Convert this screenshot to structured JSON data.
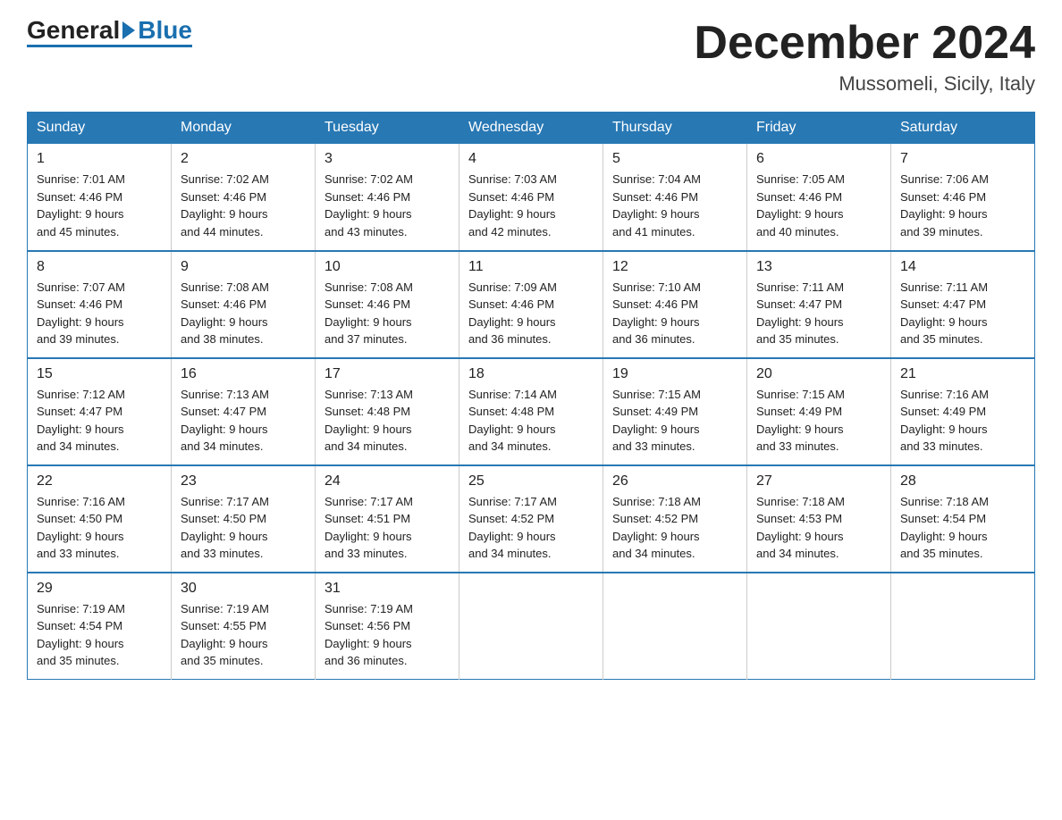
{
  "logo": {
    "general": "General",
    "blue": "Blue"
  },
  "header": {
    "month": "December 2024",
    "location": "Mussomeli, Sicily, Italy"
  },
  "days_of_week": [
    "Sunday",
    "Monday",
    "Tuesday",
    "Wednesday",
    "Thursday",
    "Friday",
    "Saturday"
  ],
  "weeks": [
    [
      {
        "num": "1",
        "info": "Sunrise: 7:01 AM\nSunset: 4:46 PM\nDaylight: 9 hours\nand 45 minutes."
      },
      {
        "num": "2",
        "info": "Sunrise: 7:02 AM\nSunset: 4:46 PM\nDaylight: 9 hours\nand 44 minutes."
      },
      {
        "num": "3",
        "info": "Sunrise: 7:02 AM\nSunset: 4:46 PM\nDaylight: 9 hours\nand 43 minutes."
      },
      {
        "num": "4",
        "info": "Sunrise: 7:03 AM\nSunset: 4:46 PM\nDaylight: 9 hours\nand 42 minutes."
      },
      {
        "num": "5",
        "info": "Sunrise: 7:04 AM\nSunset: 4:46 PM\nDaylight: 9 hours\nand 41 minutes."
      },
      {
        "num": "6",
        "info": "Sunrise: 7:05 AM\nSunset: 4:46 PM\nDaylight: 9 hours\nand 40 minutes."
      },
      {
        "num": "7",
        "info": "Sunrise: 7:06 AM\nSunset: 4:46 PM\nDaylight: 9 hours\nand 39 minutes."
      }
    ],
    [
      {
        "num": "8",
        "info": "Sunrise: 7:07 AM\nSunset: 4:46 PM\nDaylight: 9 hours\nand 39 minutes."
      },
      {
        "num": "9",
        "info": "Sunrise: 7:08 AM\nSunset: 4:46 PM\nDaylight: 9 hours\nand 38 minutes."
      },
      {
        "num": "10",
        "info": "Sunrise: 7:08 AM\nSunset: 4:46 PM\nDaylight: 9 hours\nand 37 minutes."
      },
      {
        "num": "11",
        "info": "Sunrise: 7:09 AM\nSunset: 4:46 PM\nDaylight: 9 hours\nand 36 minutes."
      },
      {
        "num": "12",
        "info": "Sunrise: 7:10 AM\nSunset: 4:46 PM\nDaylight: 9 hours\nand 36 minutes."
      },
      {
        "num": "13",
        "info": "Sunrise: 7:11 AM\nSunset: 4:47 PM\nDaylight: 9 hours\nand 35 minutes."
      },
      {
        "num": "14",
        "info": "Sunrise: 7:11 AM\nSunset: 4:47 PM\nDaylight: 9 hours\nand 35 minutes."
      }
    ],
    [
      {
        "num": "15",
        "info": "Sunrise: 7:12 AM\nSunset: 4:47 PM\nDaylight: 9 hours\nand 34 minutes."
      },
      {
        "num": "16",
        "info": "Sunrise: 7:13 AM\nSunset: 4:47 PM\nDaylight: 9 hours\nand 34 minutes."
      },
      {
        "num": "17",
        "info": "Sunrise: 7:13 AM\nSunset: 4:48 PM\nDaylight: 9 hours\nand 34 minutes."
      },
      {
        "num": "18",
        "info": "Sunrise: 7:14 AM\nSunset: 4:48 PM\nDaylight: 9 hours\nand 34 minutes."
      },
      {
        "num": "19",
        "info": "Sunrise: 7:15 AM\nSunset: 4:49 PM\nDaylight: 9 hours\nand 33 minutes."
      },
      {
        "num": "20",
        "info": "Sunrise: 7:15 AM\nSunset: 4:49 PM\nDaylight: 9 hours\nand 33 minutes."
      },
      {
        "num": "21",
        "info": "Sunrise: 7:16 AM\nSunset: 4:49 PM\nDaylight: 9 hours\nand 33 minutes."
      }
    ],
    [
      {
        "num": "22",
        "info": "Sunrise: 7:16 AM\nSunset: 4:50 PM\nDaylight: 9 hours\nand 33 minutes."
      },
      {
        "num": "23",
        "info": "Sunrise: 7:17 AM\nSunset: 4:50 PM\nDaylight: 9 hours\nand 33 minutes."
      },
      {
        "num": "24",
        "info": "Sunrise: 7:17 AM\nSunset: 4:51 PM\nDaylight: 9 hours\nand 33 minutes."
      },
      {
        "num": "25",
        "info": "Sunrise: 7:17 AM\nSunset: 4:52 PM\nDaylight: 9 hours\nand 34 minutes."
      },
      {
        "num": "26",
        "info": "Sunrise: 7:18 AM\nSunset: 4:52 PM\nDaylight: 9 hours\nand 34 minutes."
      },
      {
        "num": "27",
        "info": "Sunrise: 7:18 AM\nSunset: 4:53 PM\nDaylight: 9 hours\nand 34 minutes."
      },
      {
        "num": "28",
        "info": "Sunrise: 7:18 AM\nSunset: 4:54 PM\nDaylight: 9 hours\nand 35 minutes."
      }
    ],
    [
      {
        "num": "29",
        "info": "Sunrise: 7:19 AM\nSunset: 4:54 PM\nDaylight: 9 hours\nand 35 minutes."
      },
      {
        "num": "30",
        "info": "Sunrise: 7:19 AM\nSunset: 4:55 PM\nDaylight: 9 hours\nand 35 minutes."
      },
      {
        "num": "31",
        "info": "Sunrise: 7:19 AM\nSunset: 4:56 PM\nDaylight: 9 hours\nand 36 minutes."
      },
      {
        "num": "",
        "info": ""
      },
      {
        "num": "",
        "info": ""
      },
      {
        "num": "",
        "info": ""
      },
      {
        "num": "",
        "info": ""
      }
    ]
  ]
}
